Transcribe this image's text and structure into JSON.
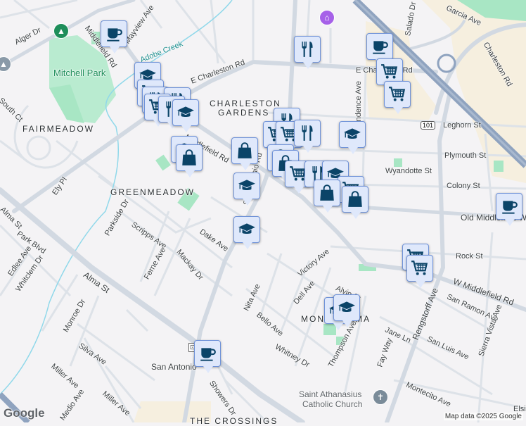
{
  "map": {
    "neighborhoods": [
      "CHARLESTON",
      "GARDENS",
      "FAIRMEADOW",
      "GREENMEADOW",
      "MONTA LOMA",
      "THE CROSSINGS"
    ],
    "parks": [
      "Mitchell Park"
    ],
    "waterways": [
      "Adobe Creek"
    ],
    "streets": [
      "Alger Dr",
      "Middlefield Rd",
      "Mayview Ave",
      "E Charleston Rd",
      "E Charleston Rd",
      "Middlefield Rd",
      "San Antonio Rd",
      "Leghorn St",
      "Independence Ave",
      "Salado Dr",
      "Garcia Ave",
      "Charleston Rd",
      "Plymouth St",
      "Wyandotte St",
      "Colony St",
      "Old Middlefield Way",
      "Rock St",
      "W Middlefield Rd",
      "Ely Pl",
      "Alma St",
      "Park Blvd",
      "Edlee Ave",
      "Whitclem Dr",
      "Parkside Dr",
      "Scripps Ave",
      "Dake Ave",
      "Mackay Dr",
      "Ferne Ave",
      "Monroe Dr",
      "Silva Ave",
      "Miller Ave",
      "Miller Ave",
      "Medio Ave",
      "Nita Ave",
      "Bello Ave",
      "Victory Ave",
      "Dell Ave",
      "Alvin St",
      "Whitney Dr",
      "Thompson Ave",
      "Fay Way",
      "Jane Ln",
      "Rengstorff Ave",
      "San Ramon Ave",
      "San Luis Ave",
      "Sierra Vista Ave",
      "Montecito Ave",
      "Showers Dr",
      "Elsie",
      "South Ct",
      "Alma St"
    ],
    "highway_shield": "101",
    "transit_label": "San Antonio",
    "places": [
      "Saint Athanasius",
      "Catholic Church"
    ],
    "attribution": "Map data ©2025 Google",
    "logo": "Google"
  },
  "markers": [
    {
      "type": "coffee"
    },
    {
      "type": "school"
    },
    {
      "type": "cart"
    },
    {
      "type": "restaurant"
    },
    {
      "type": "restaurant"
    },
    {
      "type": "cart"
    },
    {
      "type": "restaurant"
    },
    {
      "type": "school"
    },
    {
      "type": "school"
    },
    {
      "type": "bag"
    },
    {
      "type": "bag"
    },
    {
      "type": "school"
    },
    {
      "type": "school"
    },
    {
      "type": "restaurant"
    },
    {
      "type": "coffee"
    },
    {
      "type": "cart"
    },
    {
      "type": "cart"
    },
    {
      "type": "restaurant"
    },
    {
      "type": "cart"
    },
    {
      "type": "cart"
    },
    {
      "type": "restaurant"
    },
    {
      "type": "school"
    },
    {
      "type": "bag"
    },
    {
      "type": "bag"
    },
    {
      "type": "cart"
    },
    {
      "type": "restaurant"
    },
    {
      "type": "school"
    },
    {
      "type": "cart"
    },
    {
      "type": "bag"
    },
    {
      "type": "bag"
    },
    {
      "type": "coffee"
    },
    {
      "type": "cart"
    },
    {
      "type": "cart"
    },
    {
      "type": "school"
    },
    {
      "type": "school"
    },
    {
      "type": "coffee"
    }
  ],
  "colors": {
    "marker_fill": "#dfe8fb",
    "marker_border": "#6f92d8",
    "icon": "#0b4468",
    "park": "#a8e6c4",
    "road": "#d4dbe3",
    "highway": "#8fa3bf"
  }
}
